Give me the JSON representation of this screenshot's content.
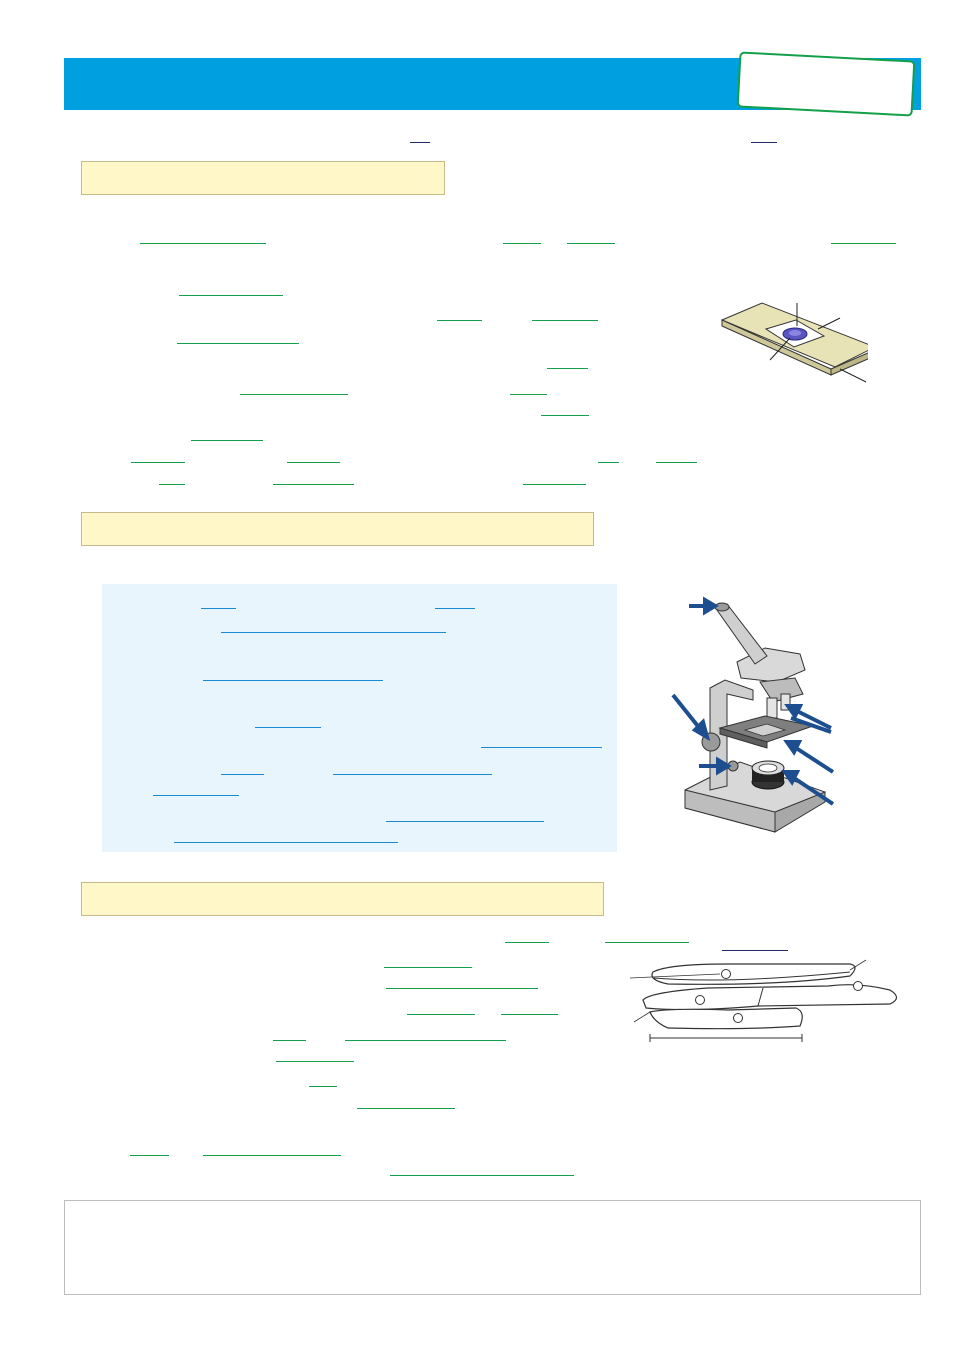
{
  "colors": {
    "header": "#00a0e0",
    "stamp_border": "#12a04a",
    "section_fill": "#fff7c8",
    "panel_fill": "#e8f5fc",
    "answer_line_green": "#12a04a",
    "answer_line_navy": "#222a6a",
    "answer_line_blue": "#1a8ad0",
    "arrow": "#1d4e8f"
  },
  "sections": [
    {
      "id": "section-1",
      "label": ""
    },
    {
      "id": "section-2",
      "label": ""
    },
    {
      "id": "section-3",
      "label": ""
    }
  ],
  "icons": [
    "slide-illustration",
    "microscope-illustration",
    "arrow-icon",
    "forceps-illustration"
  ]
}
